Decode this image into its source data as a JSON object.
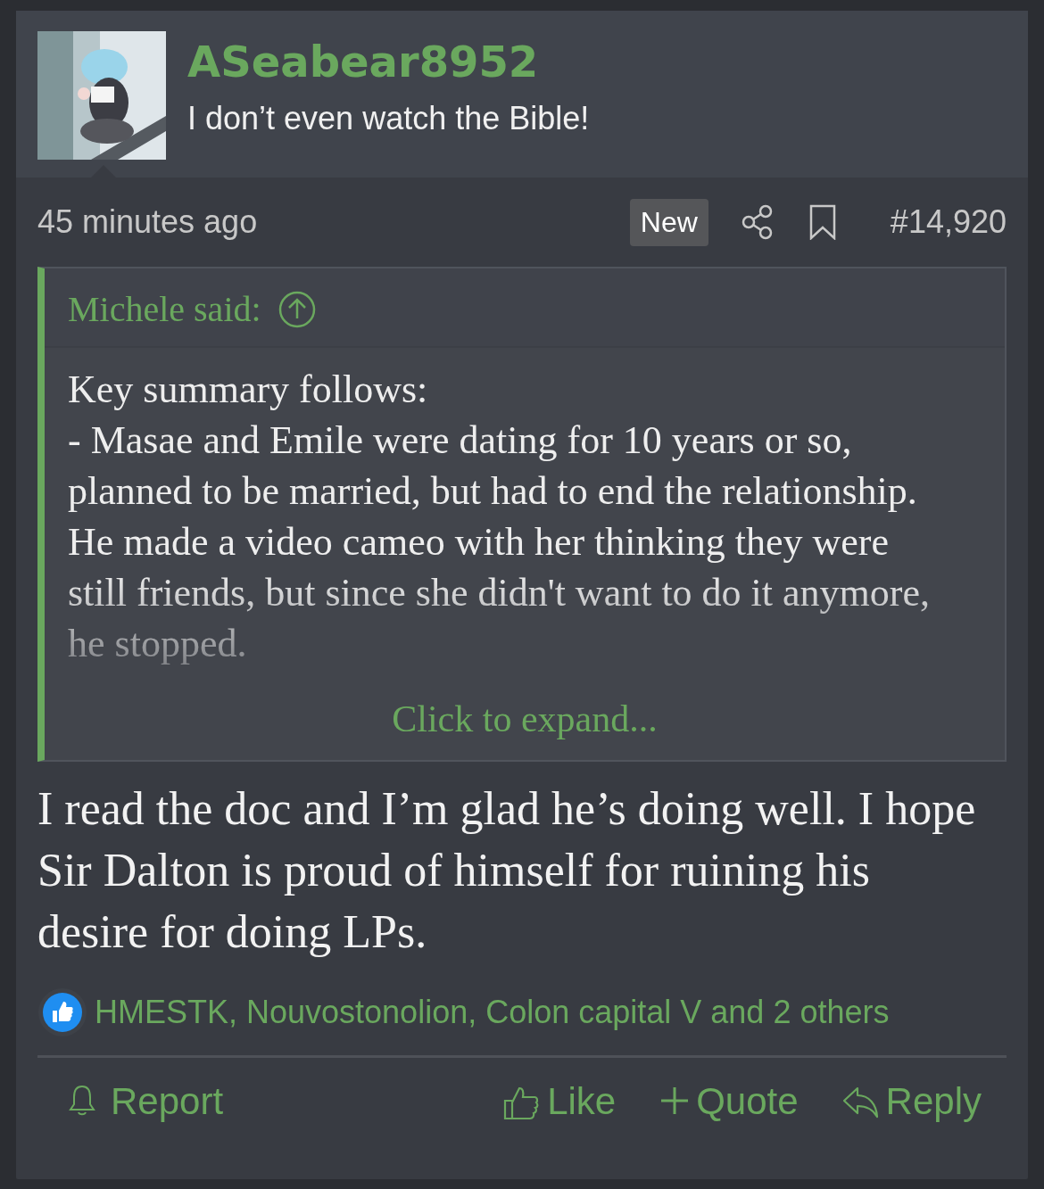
{
  "post": {
    "author": "ASeabear8952",
    "user_title": "I don’t even watch the Bible!",
    "time": "45 minutes ago",
    "badge": "New",
    "number": "#14,920",
    "quote": {
      "attribution": "Michele said:",
      "paragraphs": [
        "Key summary follows:",
        "- Masae and Emile were dating for 10 years or so, planned to be married, but had to end the relationship. He made a video cameo with her thinking they were still friends, but since she didn't want to do it anymore, he stopped."
      ],
      "expand": "Click to expand..."
    },
    "message": "I read the doc and I’m glad he’s doing well. I hope Sir Dalton is proud of himself for ruining his desire for doing LPs.",
    "reactions": "HMESTK, Nouvostonolion, Colon capital V and 2 others",
    "actions": [
      {
        "kind": "report",
        "label": "Report"
      },
      {
        "kind": "like",
        "label": "Like"
      },
      {
        "kind": "quote",
        "label": "Quote"
      },
      {
        "kind": "reply",
        "label": "Reply"
      }
    ]
  }
}
